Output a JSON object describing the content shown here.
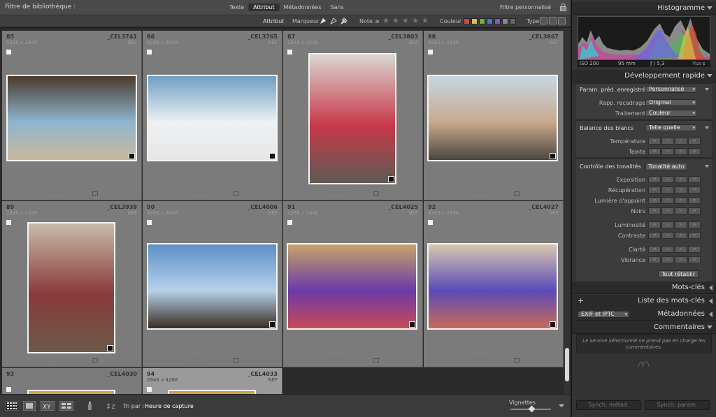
{
  "filter_bar": {
    "title": "Filtre de bibliothèque :",
    "tabs": [
      "Texte",
      "Attribut",
      "Métadonnées",
      "Sans"
    ],
    "active_tab": "Attribut",
    "preset": "Filtre personnalisé"
  },
  "attribute_bar": {
    "attribute_label": "Attribut",
    "flag_label": "Marqueur",
    "rating_label": "Note",
    "rating_op": "≥",
    "color_label": "Couleur",
    "type_label": "Type",
    "color_swatches": [
      "#c74a4a",
      "#d1c34a",
      "#6bb04a",
      "#4a77c7",
      "#8a54b8",
      "#888888",
      "#666666"
    ]
  },
  "grid": {
    "cells": [
      {
        "index": "85",
        "file": "_CEL3741",
        "dims": "4288 x 2848",
        "type": "NEF",
        "colors": [
          "#4a3a2c",
          "#8fb5cf",
          "#c9b99c"
        ]
      },
      {
        "index": "86",
        "file": "_CEL3765",
        "dims": "4288 x 2848",
        "type": "NEF",
        "colors": [
          "#6e9fc4",
          "#eef1f3",
          "#e6e6e6"
        ]
      },
      {
        "index": "87",
        "file": "_CEL3803",
        "dims": "2848 x 4288",
        "type": "NEF",
        "colors": [
          "#d9d7d2",
          "#c9394a",
          "#5d5a53"
        ]
      },
      {
        "index": "88",
        "file": "_CEL3867",
        "dims": "4288 x 2848",
        "type": "NEF",
        "colors": [
          "#c5d7e4",
          "#c9a98c",
          "#4b4640"
        ]
      },
      {
        "index": "89",
        "file": "_CEL3939",
        "dims": "2848 x 4288",
        "type": "NEF",
        "colors": [
          "#c8bca8",
          "#8a3a3a",
          "#6b5a48"
        ]
      },
      {
        "index": "90",
        "file": "_CEL4006",
        "dims": "4288 x 2848",
        "type": "NEF",
        "colors": [
          "#5d8fc8",
          "#b6d2ea",
          "#3a2d22"
        ]
      },
      {
        "index": "91",
        "file": "_CEL4025",
        "dims": "4288 x 2848",
        "type": "NEF",
        "colors": [
          "#c8a36a",
          "#6a3aa8",
          "#c84a5a"
        ]
      },
      {
        "index": "92",
        "file": "_CEL4027",
        "dims": "4288 x 2848",
        "type": "NEF",
        "colors": [
          "#d9c8b0",
          "#5a4ab8",
          "#c86a5a"
        ]
      },
      {
        "index": "93",
        "file": "_CEL4030",
        "dims": "",
        "type": "",
        "colors": [
          "#cba04a",
          "#e6d6b8",
          "#aaaaaa"
        ]
      },
      {
        "index": "94",
        "file": "_CEL4033",
        "dims": "2848 x 4288",
        "type": "NEF",
        "colors": [
          "#c89a4a",
          "#e6d6b8",
          "#aaaaaa"
        ]
      }
    ]
  },
  "toolbar": {
    "sort_label": "Tri par :",
    "sort_value": "Heure de capture",
    "thumbnails_label": "Vignettes"
  },
  "right_panel": {
    "histogram": {
      "title": "Histogramme",
      "iso": "ISO 200",
      "focal": "95 mm",
      "aperture": "ƒ / 5,3",
      "shutter": "¹⁄₁₂₅ s"
    },
    "quick_develop": {
      "title": "Développement rapide",
      "preset_label": "Param. préd. enregistré",
      "preset_value": "Personnalisé",
      "crop_label": "Rapp. recadrage",
      "crop_value": "Original",
      "treatment_label": "Traitement",
      "treatment_value": "Couleur",
      "wb_label": "Balance des blancs",
      "wb_value": "Telle quelle",
      "temperature_label": "Température",
      "tint_label": "Teinte",
      "tone_label": "Contrôle des tonalités",
      "auto_tone": "Tonalité auto",
      "exposure_label": "Exposition",
      "recovery_label": "Récupération",
      "fill_light_label": "Lumière d'appoint",
      "blacks_label": "Noirs",
      "brightness_label": "Luminosité",
      "contrast_label": "Contraste",
      "clarity_label": "Clarté",
      "vibrance_label": "Vibrance",
      "reset_all": "Tout rétablir"
    },
    "keywords_title": "Mots-clés",
    "keyword_list_title": "Liste des mots-clés",
    "metadata_title": "Métadonnées",
    "metadata_preset": "EXIF et IPTC",
    "comments_title": "Commentaires",
    "comments_note": "Le service sélectionné ne prend pas en charge les commentaires.",
    "sync_metadata": "Synch. métad.",
    "sync_settings": "Synch. param."
  }
}
